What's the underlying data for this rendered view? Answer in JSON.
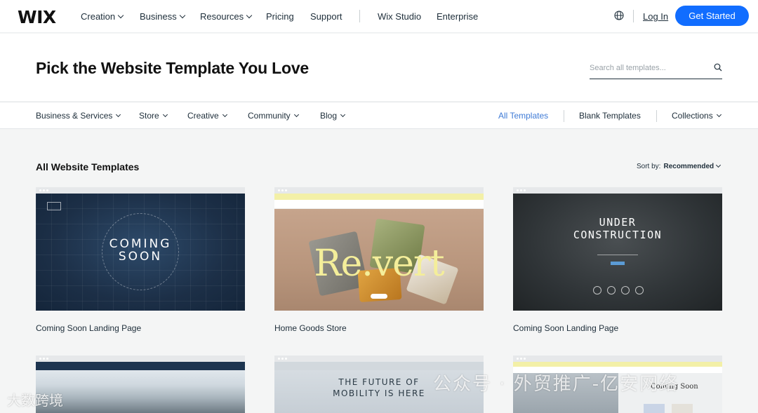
{
  "nav": {
    "logo": "WIX",
    "items": [
      {
        "label": "Creation",
        "dropdown": true
      },
      {
        "label": "Business",
        "dropdown": true
      },
      {
        "label": "Resources",
        "dropdown": true
      },
      {
        "label": "Pricing",
        "dropdown": false
      },
      {
        "label": "Support",
        "dropdown": false
      },
      {
        "label": "Wix Studio",
        "dropdown": false
      },
      {
        "label": "Enterprise",
        "dropdown": false
      }
    ],
    "globe_icon": "globe-icon",
    "login": "Log In",
    "cta": "Get Started",
    "cta_color": "#116dff"
  },
  "header": {
    "title": "Pick the Website Template You Love",
    "search_placeholder": "Search all templates...",
    "search_icon": "search-icon"
  },
  "categories": {
    "left": [
      {
        "label": "Business & Services",
        "dropdown": true
      },
      {
        "label": "Store",
        "dropdown": true
      },
      {
        "label": "Creative",
        "dropdown": true
      },
      {
        "label": "Community",
        "dropdown": true
      },
      {
        "label": "Blog",
        "dropdown": true
      }
    ],
    "right": [
      {
        "label": "All Templates",
        "active": true,
        "dropdown": false
      },
      {
        "label": "Blank Templates",
        "active": false,
        "dropdown": false
      },
      {
        "label": "Collections",
        "active": false,
        "dropdown": true
      }
    ],
    "active_color": "#3f7bd6"
  },
  "section": {
    "title": "All Website Templates",
    "sort_label": "Sort by:",
    "sort_value": "Recommended"
  },
  "templates": [
    {
      "name": "Coming Soon Landing Page",
      "thumb_text": [
        "COMING",
        "SOON"
      ]
    },
    {
      "name": "Home Goods Store",
      "thumb_text": [
        "Re.vert"
      ]
    },
    {
      "name": "Coming Soon Landing Page",
      "thumb_text": [
        "UNDER",
        "CONSTRUCTION"
      ]
    },
    {
      "name": "",
      "thumb_text": []
    },
    {
      "name": "",
      "thumb_text": [
        "THE FUTURE OF",
        "MOBILITY IS HERE"
      ]
    },
    {
      "name": "",
      "thumb_text": [
        "Coming Soon"
      ]
    }
  ],
  "watermark": {
    "main": "公众号 · 外贸推广-亿安网络",
    "corner": "大数跨境"
  }
}
